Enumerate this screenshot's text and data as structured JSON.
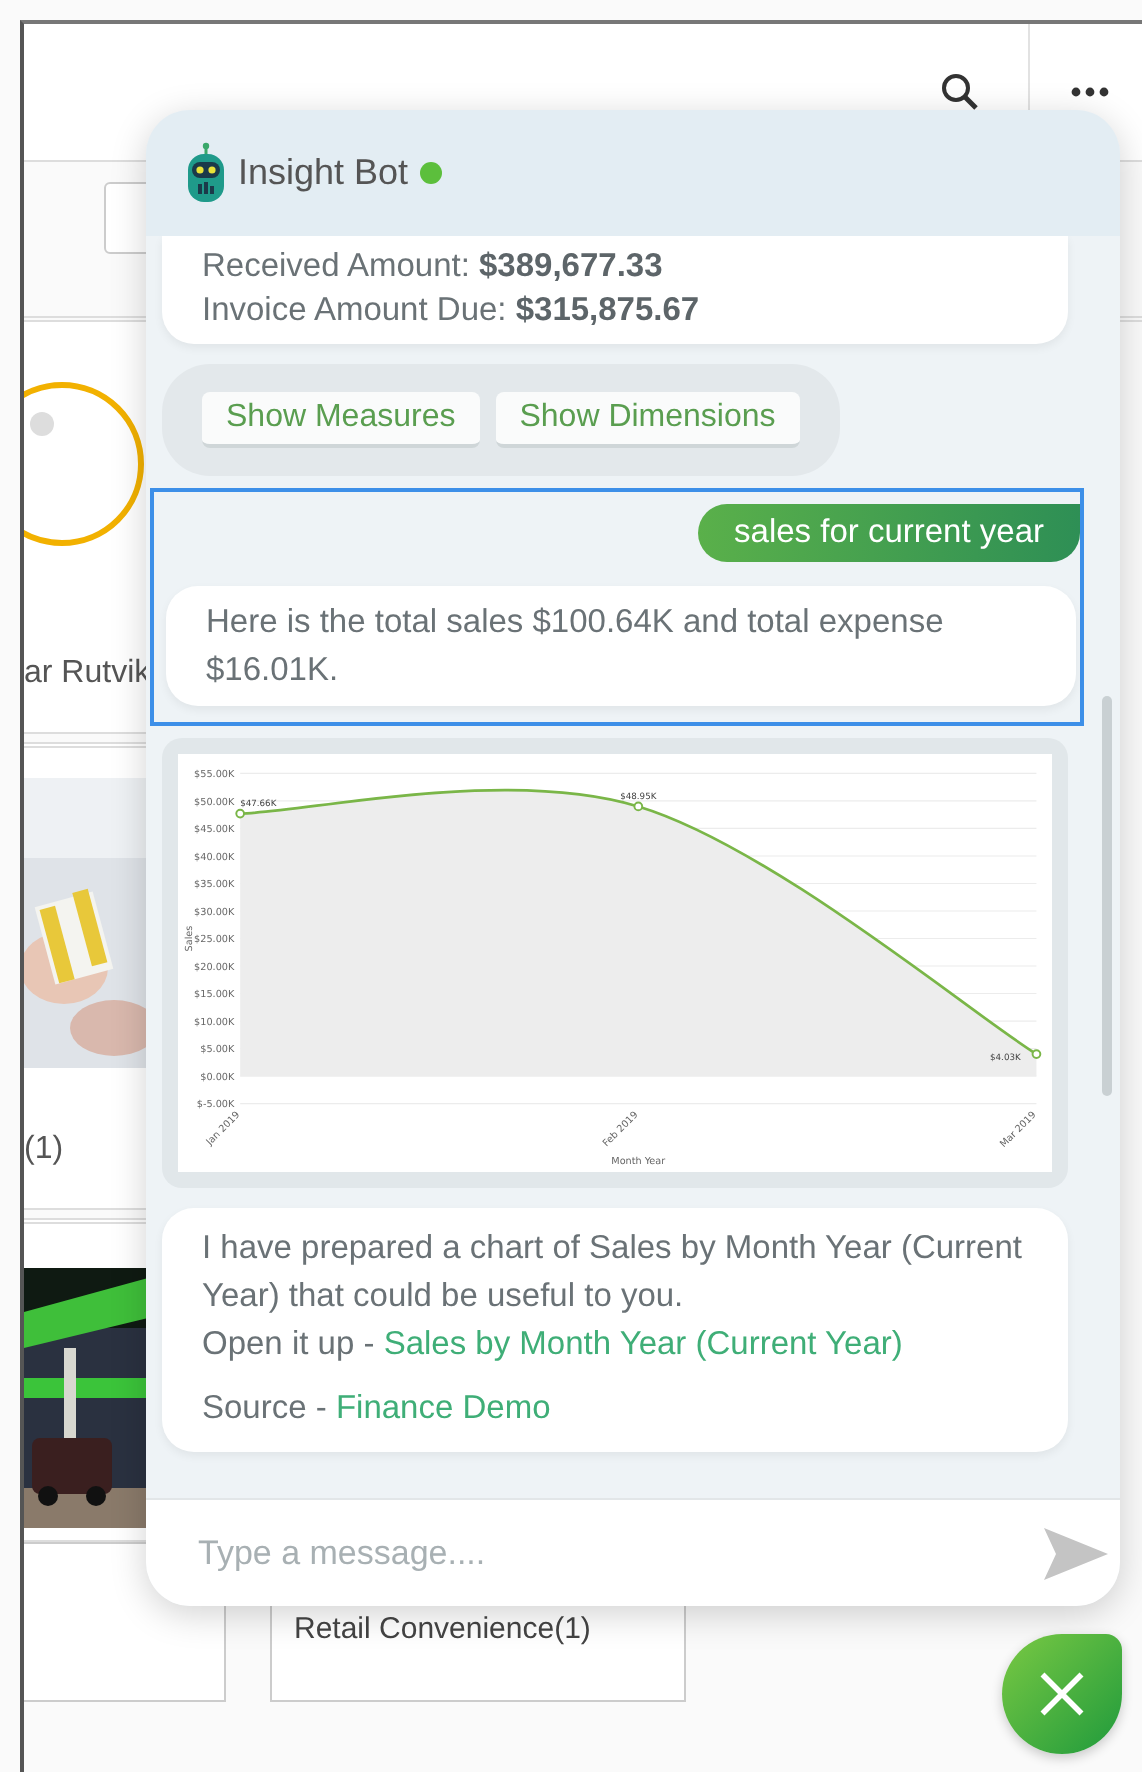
{
  "background": {
    "card_1_caption": "ar Rutvik",
    "card_2_caption": "(1)",
    "card_4_caption": "Retail Convenience(1)"
  },
  "chat": {
    "title": "Insight Bot",
    "online": true,
    "messages": [
      {
        "kind": "bot",
        "lines": [
          "Received Amount: **$389,677.33**",
          "Invoice Amount Due: **$315,875.67**"
        ]
      },
      {
        "kind": "actions",
        "buttons": [
          "Show Measures",
          "Show Dimensions"
        ]
      },
      {
        "kind": "exchange",
        "selected": true,
        "question": "sales for current year",
        "answer": "Here is the total sales $100.64K and total expense $16.01K."
      },
      {
        "kind": "chart",
        "chart_data": {
          "type": "area",
          "grid": true,
          "xlabel": "Month Year",
          "ylabel": "Sales",
          "categories": [
            "Jan 2019",
            "Feb 2019",
            "Mar 2019"
          ],
          "series": [
            {
              "color": "#7ab648",
              "marker": "o",
              "values": [
                47.7,
                49,
                4
              ]
            }
          ],
          "ylim": [
            -5,
            55
          ],
          "yticks": [
            {
              "value": 55,
              "label": "$55.00K"
            },
            {
              "value": 50,
              "label": "$50.00K"
            },
            {
              "value": 45,
              "label": "$45.00K"
            },
            {
              "value": 40,
              "label": "$40.00K"
            },
            {
              "value": 35,
              "label": "$35.00K"
            },
            {
              "value": 30,
              "label": "$30.00K"
            },
            {
              "value": 25,
              "label": "$25.00K"
            },
            {
              "value": 20,
              "label": "$20.00K"
            },
            {
              "value": 15,
              "label": "$15.00K"
            },
            {
              "value": 10,
              "label": "$10.00K"
            },
            {
              "value": 5,
              "label": "$5.00K"
            },
            {
              "value": 0,
              "label": "$0.00K"
            },
            {
              "value": -5,
              "label": "$-5.00K"
            }
          ],
          "value_labels": [
            "$47.66K",
            "$48.95K",
            "$4.03K"
          ]
        }
      },
      {
        "kind": "report",
        "text": "I have prepared a chart of Sales by Month Year (Current Year) that could be useful to you.",
        "link_label": "Open it up -",
        "link": "Sales by Month Year (Current Year)",
        "source_label": "Source -",
        "source": "Finance Demo"
      }
    ],
    "input": {
      "placeholder": "Type a message...."
    }
  }
}
